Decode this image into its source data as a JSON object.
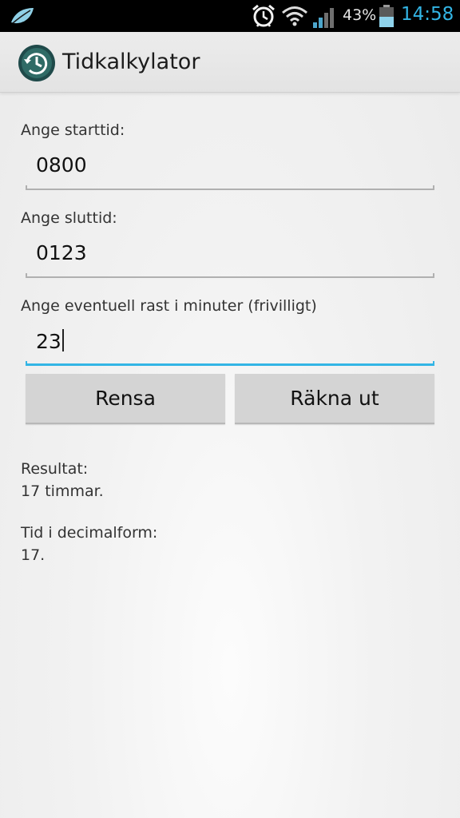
{
  "status_bar": {
    "battery_percent": "43%",
    "time": "14:58",
    "icons": [
      "leaf-icon",
      "alarm-icon",
      "wifi-icon",
      "signal-icon",
      "battery-icon"
    ],
    "clock_color": "#33b5e5",
    "battery_color": "#33b5e5"
  },
  "action_bar": {
    "title": "Tidkalkylator",
    "icon": "history-clock-icon"
  },
  "form": {
    "start_label": "Ange starttid:",
    "start_value": "0800",
    "end_label": "Ange sluttid:",
    "end_value": "0123",
    "break_label": "Ange eventuell rast i minuter (frivilligt)",
    "break_value": "23",
    "focused_field": "break",
    "accent_color": "#33b5e5"
  },
  "buttons": {
    "clear_label": "Rensa",
    "calculate_label": "Räkna ut"
  },
  "results": {
    "result_label": "Resultat:",
    "result_value": "17 timmar.",
    "decimal_label": "Tid i decimalform:",
    "decimal_value": "17."
  }
}
